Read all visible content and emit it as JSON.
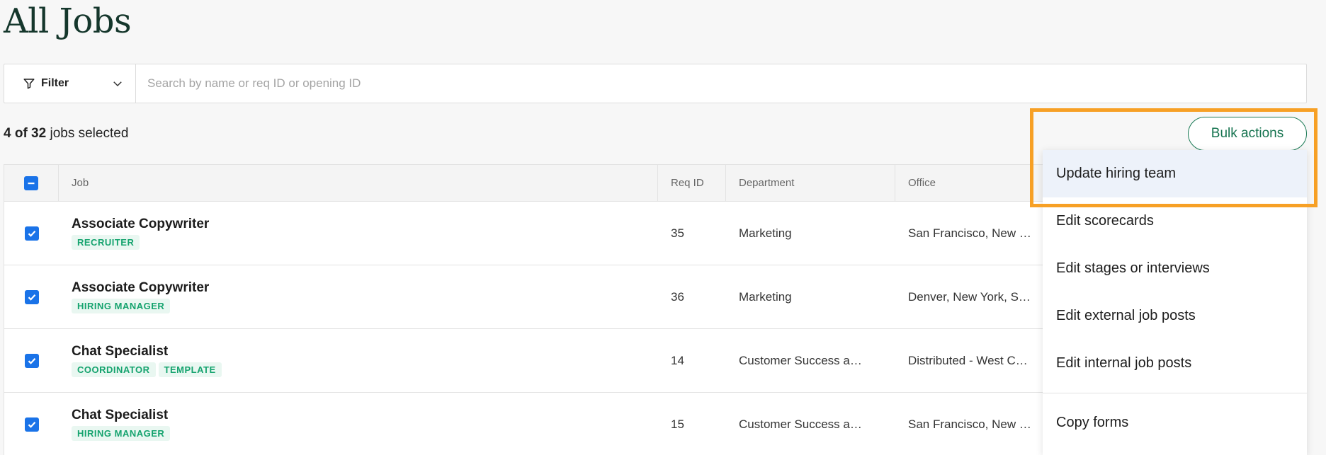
{
  "page": {
    "title": "All Jobs"
  },
  "filter": {
    "label": "Filter"
  },
  "search": {
    "placeholder": "Search by name or req ID or opening ID",
    "value": ""
  },
  "selection": {
    "count_text": "4 of 32",
    "suffix": " jobs selected"
  },
  "bulk_actions": {
    "label": "Bulk actions",
    "menu": [
      "Update hiring team",
      "Edit scorecards",
      "Edit stages or interviews",
      "Edit external job posts",
      "Edit internal job posts",
      "Copy forms"
    ],
    "highlighted_item": "Update hiring team"
  },
  "table": {
    "columns": [
      "Job",
      "Req ID",
      "Department",
      "Office"
    ],
    "rows": [
      {
        "job": "Associate Copywriter",
        "tags": [
          "RECRUITER"
        ],
        "req_id": "35",
        "department": "Marketing",
        "office": "San Francisco, New …",
        "checked": true
      },
      {
        "job": "Associate Copywriter",
        "tags": [
          "HIRING MANAGER"
        ],
        "req_id": "36",
        "department": "Marketing",
        "office": "Denver, New York, S…",
        "checked": true
      },
      {
        "job": "Chat Specialist",
        "tags": [
          "COORDINATOR",
          "TEMPLATE"
        ],
        "req_id": "14",
        "department": "Customer Success a…",
        "office": "Distributed - West C…",
        "checked": true
      },
      {
        "job": "Chat Specialist",
        "tags": [
          "HIRING MANAGER"
        ],
        "req_id": "15",
        "department": "Customer Success a…",
        "office": "San Francisco, New …",
        "checked": true
      }
    ]
  },
  "colors": {
    "accent_green": "#15734f",
    "checkbox_blue": "#1a73e8",
    "tag_green": "#15a36e",
    "highlight_orange": "#f7a025"
  }
}
